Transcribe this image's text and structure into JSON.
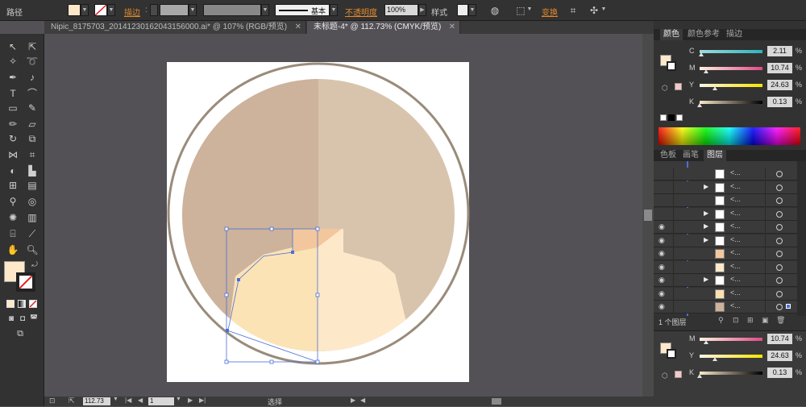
{
  "control_bar": {
    "path_label": "路径",
    "stroke_label": "描边",
    "stroke_style": "基本",
    "opacity_label": "不透明度",
    "opacity_value": "100%",
    "style_label": "样式",
    "transform_label": "变换"
  },
  "doc_tabs": [
    {
      "title": "Nipic_8175703_20141230162043156000.ai* @ 107% (RGB/预览)"
    },
    {
      "title": "未标题-4* @ 112.73% (CMYK/预览)"
    }
  ],
  "color_panel": {
    "tabs": [
      "颜色",
      "颜色参考",
      "描边"
    ],
    "sliders": [
      {
        "key": "C",
        "value": "2.11",
        "fraction": 0.0211,
        "gradient": "#9ed9dc,#2cb5bf"
      },
      {
        "key": "M",
        "value": "10.74",
        "fraction": 0.1074,
        "gradient": "#fff1dc,#e0498a"
      },
      {
        "key": "Y",
        "value": "24.63",
        "fraction": 0.2463,
        "gradient": "#fbf3e9,#f7e400"
      },
      {
        "key": "K",
        "value": "0.13",
        "fraction": 0.0013,
        "gradient": "#fde9ca,#000000"
      }
    ],
    "pct": "%"
  },
  "layers_panel": {
    "tabs": [
      "色板",
      "画笔",
      "图层"
    ],
    "rows": [
      {
        "eye": "",
        "tri": "",
        "thumb": "#ffffff",
        "name": "<...",
        "tri_show": false
      },
      {
        "eye": "",
        "tri": "▶",
        "thumb": "#ffffff",
        "name": "<...",
        "tri_show": true
      },
      {
        "eye": "",
        "tri": "",
        "thumb": "#ffffff",
        "name": "<...",
        "tri_show": false
      },
      {
        "eye": "",
        "tri": "▶",
        "thumb": "#ffffff",
        "name": "<...",
        "tri_show": true
      },
      {
        "eye": "◉",
        "tri": "▶",
        "thumb": "#ffffff",
        "name": "<...",
        "tri_show": true
      },
      {
        "eye": "◉",
        "tri": "▶",
        "thumb": "#ffffff",
        "name": "<...",
        "tri_show": true
      },
      {
        "eye": "◉",
        "tri": "",
        "thumb": "#f3c79d",
        "name": "<...",
        "tri_show": false
      },
      {
        "eye": "◉",
        "tri": "",
        "thumb": "#fde9ca",
        "name": "<...",
        "tri_show": false
      },
      {
        "eye": "◉",
        "tri": "▶",
        "thumb": "#ffffff",
        "name": "<...",
        "tri_show": true
      },
      {
        "eye": "◉",
        "tri": "",
        "thumb": "#fbe1b2",
        "name": "<...",
        "tri_show": false
      },
      {
        "eye": "◉",
        "tri": "",
        "thumb": "#cdb29c",
        "name": "<...",
        "tri_show": false
      }
    ],
    "layer_count": "1 个图层"
  },
  "status_bar": {
    "zoom": "112.73",
    "page": "1",
    "tool": "选择"
  },
  "colors": {
    "fill_swatch": "#fde9ca",
    "bg_circle": "#cdb29c",
    "bg_circle_right": "#d8c4ad",
    "ring": "#9a8b7a",
    "body_left": "#fbe3b5",
    "body_right": "#fde9ca",
    "neck": "#f3c79d",
    "selection": "#4a6fd8"
  }
}
